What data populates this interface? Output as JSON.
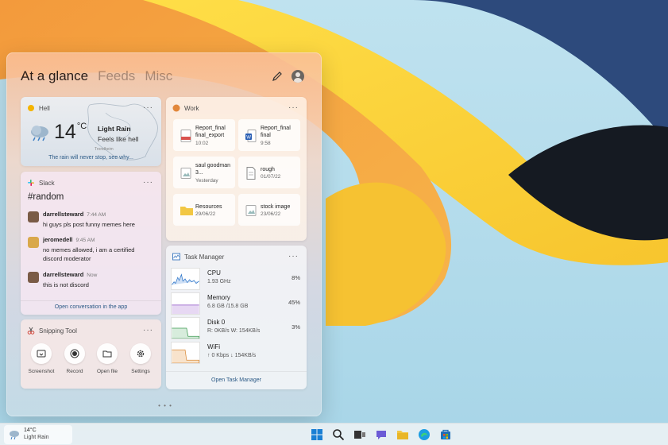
{
  "board": {
    "tabs": [
      {
        "label": "At a glance",
        "active": true
      },
      {
        "label": "Feeds",
        "active": false
      },
      {
        "label": "Misc",
        "active": false
      }
    ],
    "pager": "• • •"
  },
  "weather": {
    "title": "Hell",
    "temperature": "14",
    "unit": "°C",
    "condition": "Light Rain",
    "feels": "Feels like hell",
    "place": "Trondheim",
    "footer": "The rain will never stop, see why..."
  },
  "work": {
    "title": "Work",
    "files": [
      {
        "name": "Report_final final_export",
        "date": "10:02",
        "icon": "pdf-icon"
      },
      {
        "name": "Report_final final",
        "date": "9:58",
        "icon": "word-icon"
      },
      {
        "name": "saul goodman 3...",
        "date": "Yesterday",
        "icon": "image-icon"
      },
      {
        "name": "rough",
        "date": "01/07/22",
        "icon": "document-icon"
      },
      {
        "name": "Resources",
        "date": "29/06/22",
        "icon": "folder-icon"
      },
      {
        "name": "stock image",
        "date": "23/06/22",
        "icon": "image-icon"
      }
    ]
  },
  "slack": {
    "title": "Slack",
    "channel": "#random",
    "messages": [
      {
        "user": "darrellsteward",
        "time": "7:44 AM",
        "text": "hi guys pls post funny memes here"
      },
      {
        "user": "jeromedell",
        "time": "9:45 AM",
        "text": "no memes allowed, i am a certified discord moderator"
      },
      {
        "user": "darrellsteward",
        "time": "Now",
        "text": "this is not discord"
      }
    ],
    "footer": "Open conversation in the app"
  },
  "snipping": {
    "title": "Snipping Tool",
    "buttons": [
      {
        "label": "Screenshot"
      },
      {
        "label": "Record"
      },
      {
        "label": "Open file"
      },
      {
        "label": "Settings"
      }
    ]
  },
  "task_manager": {
    "title": "Task Manager",
    "rows": [
      {
        "name": "CPU",
        "detail": "1.93 GHz",
        "value": "8%",
        "color": "#2b74c9"
      },
      {
        "name": "Memory",
        "detail": "6.8 GB /15.8 GB",
        "value": "45%",
        "color": "#8b4fc4"
      },
      {
        "name": "Disk 0",
        "detail": "R: 0KB/s    W: 154KB/s",
        "value": "3%",
        "color": "#3e9a52"
      },
      {
        "name": "WiFi",
        "detail": "↑ 0 Kbps   ↓ 154KB/s",
        "value": "",
        "color": "#d98b3a"
      }
    ],
    "footer": "Open Task Manager"
  },
  "taskbar": {
    "weather_temp": "14°C",
    "weather_cond": "Light Rain",
    "icons": [
      "windows-start-icon",
      "search-icon",
      "task-view-icon",
      "chat-icon",
      "file-explorer-icon",
      "edge-icon",
      "store-icon"
    ]
  }
}
